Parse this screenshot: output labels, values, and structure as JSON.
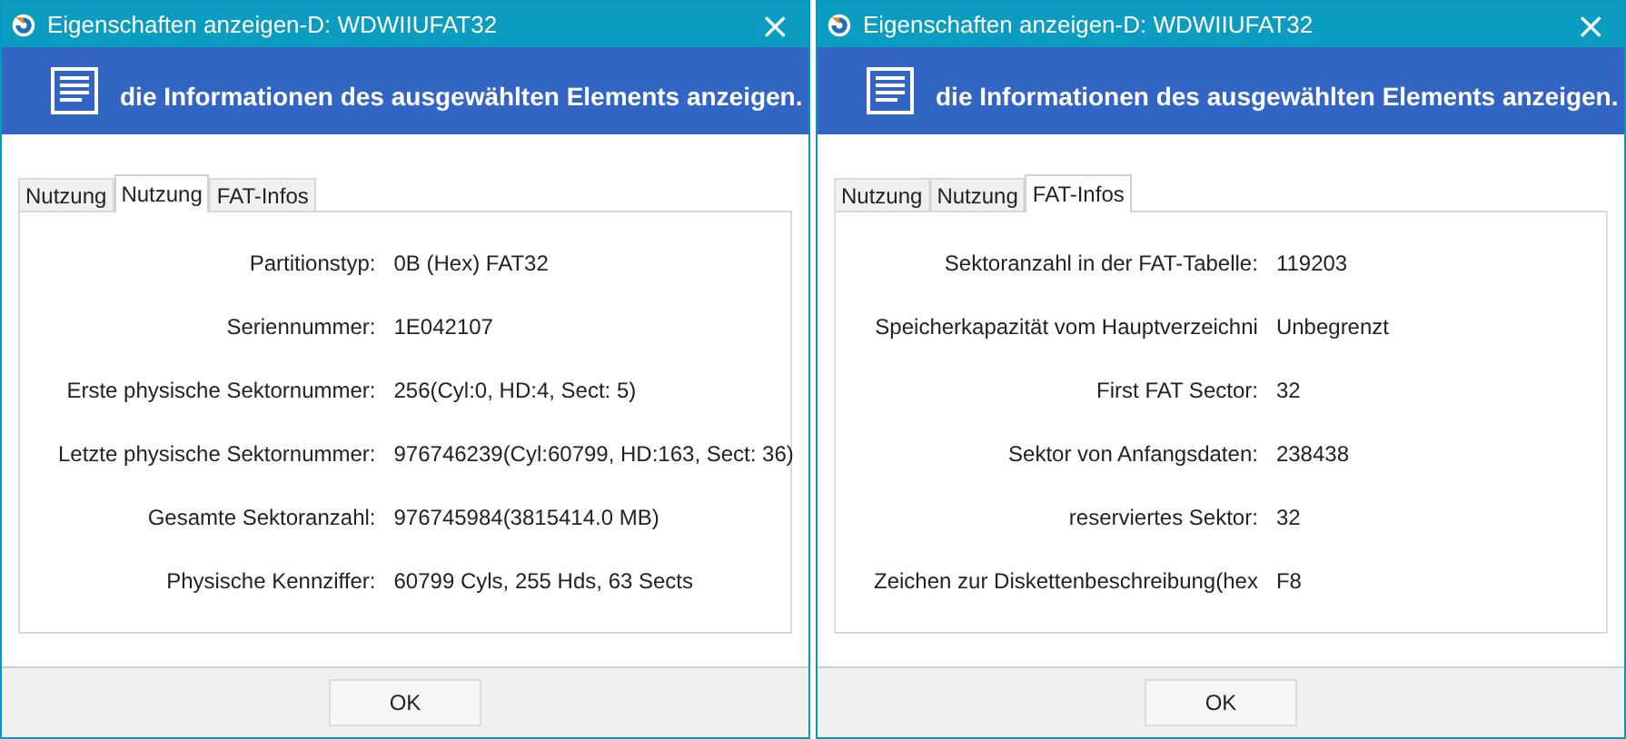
{
  "windows": [
    {
      "title": "Eigenschaften anzeigen-D: WDWIIUFAT32",
      "close": "×",
      "header": "die Informationen des ausgewählten Elements anzeigen.",
      "tabs": [
        {
          "label": "Nutzung",
          "selected": false
        },
        {
          "label": "Nutzung",
          "selected": true
        },
        {
          "label": "FAT-Infos",
          "selected": false
        }
      ],
      "fields": [
        {
          "label": "Partitionstyp:",
          "value": "0B (Hex) FAT32"
        },
        {
          "label": "Seriennummer:",
          "value": "1E042107"
        },
        {
          "label": "Erste physische Sektornummer:",
          "value": "256(Cyl:0, HD:4, Sect: 5)"
        },
        {
          "label": "Letzte physische Sektornummer:",
          "value": "976746239(Cyl:60799, HD:163, Sect: 36)"
        },
        {
          "label": "Gesamte Sektoranzahl:",
          "value": "976745984(3815414.0 MB)"
        },
        {
          "label": "Physische Kennziffer:",
          "value": "60799 Cyls, 255 Hds, 63 Sects"
        }
      ],
      "button": "OK"
    },
    {
      "title": "Eigenschaften anzeigen-D: WDWIIUFAT32",
      "close": "×",
      "header": "die Informationen des ausgewählten Elements anzeigen.",
      "tabs": [
        {
          "label": "Nutzung",
          "selected": false
        },
        {
          "label": "Nutzung",
          "selected": false
        },
        {
          "label": "FAT-Infos",
          "selected": true
        }
      ],
      "fields": [
        {
          "label": "Sektoranzahl in der FAT-Tabelle:",
          "value": "119203"
        },
        {
          "label": "Speicherkapazität vom Hauptverzeichni",
          "value": "Unbegrenzt"
        },
        {
          "label": "First FAT Sector:",
          "value": "32"
        },
        {
          "label": "Sektor von Anfangsdaten:",
          "value": "238438"
        },
        {
          "label": "reserviertes Sektor:",
          "value": "32"
        },
        {
          "label": "Zeichen zur Diskettenbeschreibung(hex",
          "value": "F8"
        }
      ],
      "button": "OK"
    }
  ]
}
